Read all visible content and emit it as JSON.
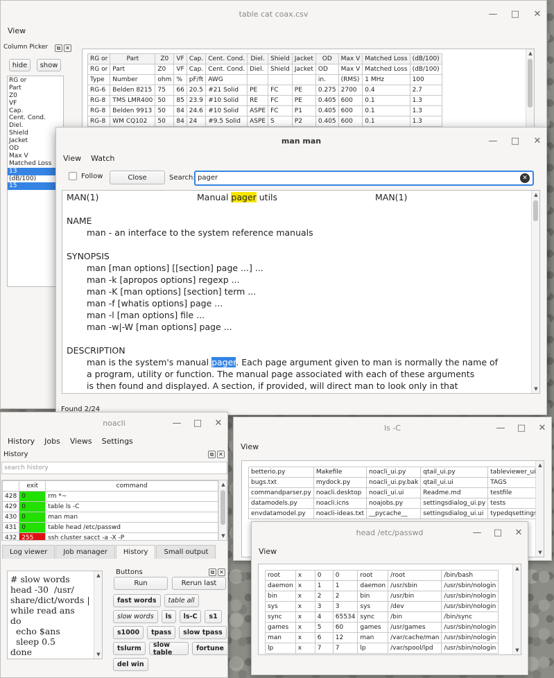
{
  "table_window": {
    "title": "table cat coax.csv",
    "menu": [
      "View"
    ],
    "picker_title": "Column Picker",
    "hide_label": "hide",
    "show_label": "show",
    "columns": [
      {
        "label": "RG or",
        "sel": false
      },
      {
        "label": "Part",
        "sel": false
      },
      {
        "label": "Z0",
        "sel": false
      },
      {
        "label": "VF",
        "sel": false
      },
      {
        "label": "Cap.",
        "sel": false
      },
      {
        "label": "Cent. Cond.",
        "sel": false
      },
      {
        "label": "Diel.",
        "sel": false
      },
      {
        "label": "Shield",
        "sel": false
      },
      {
        "label": "Jacket",
        "sel": false
      },
      {
        "label": "OD",
        "sel": false
      },
      {
        "label": "Max V",
        "sel": false
      },
      {
        "label": "Matched Loss",
        "sel": false
      },
      {
        "label": "13",
        "sel": true
      },
      {
        "label": "(dB/100)",
        "sel": false
      },
      {
        "label": "15",
        "sel": true
      }
    ],
    "headers": [
      "RG or",
      "Part",
      "Z0",
      "VF",
      "Cap.",
      "Cent. Cond.",
      "Diel.",
      "Shield",
      "Jacket",
      "OD",
      "Max V",
      "Matched Loss",
      "(dB/100)"
    ],
    "rows": [
      [
        "RG or",
        "Part",
        "Z0",
        "VF",
        "Cap.",
        "Cent. Cond.",
        "Diel.",
        "Shield",
        "Jacket",
        "OD",
        "Max V",
        "Matched Loss",
        "(dB/100)"
      ],
      [
        "Type",
        "Number",
        "ohm",
        "%",
        "pF/ft",
        "AWG",
        "",
        "",
        "",
        "in.",
        "(RMS)",
        "1 MHz",
        "100"
      ],
      [
        "RG-6",
        "Belden 8215",
        "75",
        "66",
        "20.5",
        "#21 Solid",
        "PE",
        "FC",
        "PE",
        "0.275",
        "2700",
        "0.4",
        "2.7"
      ],
      [
        "RG-8",
        "TMS LMR400",
        "50",
        "85",
        "23.9",
        "#10 Solid",
        "RE",
        "FC",
        "PE",
        "0.405",
        "600",
        "0.1",
        "1.3"
      ],
      [
        "RG-8",
        "Belden 9913",
        "50",
        "84",
        "24.6",
        "#10 Solid",
        "ASPE",
        "FC",
        "P1",
        "0.405",
        "600",
        "0.1",
        "1.3"
      ],
      [
        "RG-8",
        "WM CQ102",
        "50",
        "84",
        "24",
        "#9.5 Solid",
        "ASPE",
        "S",
        "P2",
        "0.405",
        "600",
        "0.1",
        "1.3"
      ]
    ]
  },
  "man_window": {
    "title": "man man",
    "menu": [
      "View",
      "Watch"
    ],
    "follow_label": "Follow",
    "close_label": "Close",
    "search_label": "Search:",
    "search_value": "pager",
    "status": "Found 2/24",
    "head_left": "MAN(1)",
    "head_mid_pre": "Manual ",
    "head_mid_hl": "pager",
    "head_mid_post": " utils",
    "head_right": "MAN(1)",
    "name_h": "NAME",
    "name_line": "man - an interface to the system reference manuals",
    "synopsis_h": "SYNOPSIS",
    "synopsis": [
      "man [man options] [[section] page ...] ...",
      "man -k [apropos options] regexp ...",
      "man -K [man options] [section] term ...",
      "man -f [whatis options] page ...",
      "man -l [man options] file ...",
      "man -w|-W [man options] page ..."
    ],
    "desc_h": "DESCRIPTION",
    "desc1_pre": "man is the system's manual ",
    "desc1_hl": "pager",
    "desc1_post": ".  Each page argument given to man is normally the name of",
    "desc2": "a program, utility or function.  The manual page associated with each of  these  arguments",
    "desc3": "is then found and displayed.  A section, if provided, will direct man to look only in that"
  },
  "noacli_window": {
    "title": "noacli",
    "menu": [
      "History",
      "Jobs",
      "Views",
      "Settings"
    ],
    "history_label": "History",
    "search_placeholder": "search history",
    "col_exit": "exit",
    "col_command": "command",
    "history": [
      {
        "n": "428",
        "exit": "0",
        "cmd": "rm *~",
        "ok": true
      },
      {
        "n": "429",
        "exit": "0",
        "cmd": "table ls -C",
        "ok": true
      },
      {
        "n": "430",
        "exit": "0",
        "cmd": "man man",
        "ok": true
      },
      {
        "n": "431",
        "exit": "0",
        "cmd": "table head /etc/passwd",
        "ok": true
      },
      {
        "n": "432",
        "exit": "255",
        "cmd": "ssh cluster sacct -a -X -P",
        "ok": false
      }
    ],
    "tabs": [
      "Log viewer",
      "Job manager",
      "History",
      "Small output"
    ],
    "editor_lines": [
      "# slow words",
      "head -30  /usr/",
      "share/dict/words |",
      "while read ans",
      "do",
      "  echo $ans",
      "  sleep 0.5",
      "done"
    ],
    "buttons_label": "Buttons",
    "run_label": "Run",
    "rerun_label": "Rerun last",
    "quick_buttons": [
      [
        "fast words",
        "table all"
      ],
      [
        "slow words",
        "ls",
        "ls-C",
        "s1"
      ],
      [
        "s1000",
        "tpass",
        "slow tpass"
      ],
      [
        "tslurm",
        "slow table",
        "fortune"
      ],
      [
        "del win"
      ]
    ]
  },
  "ls_window": {
    "title": "ls -C",
    "menu": [
      "View"
    ],
    "rows": [
      [
        "betterio.py",
        "Makefile",
        "noacli_ui.py",
        "qtail_ui.py",
        "tableviewer_ui.ui"
      ],
      [
        "bugs.txt",
        "mydock.py",
        "noacli_ui.py.bak",
        "qtail_ui.ui",
        "TAGS"
      ],
      [
        "commandparser.py",
        "noacli.desktop",
        "noacli_ui.ui",
        "Readme.md",
        "testfile"
      ],
      [
        "datamodels.py",
        "noacli.icns",
        "noajobs.py",
        "settingsdialog_ui.py",
        "tests"
      ],
      [
        "envdatamodel.py",
        "noacli-ideas.txt",
        "__pycache__",
        "settingsdialog_ui.ui",
        "typedqsettings.py"
      ]
    ]
  },
  "head_window": {
    "title": "head /etc/passwd",
    "menu": [
      "View"
    ],
    "rows": [
      [
        "root",
        "x",
        "0",
        "0",
        "root",
        "/root",
        "/bin/bash"
      ],
      [
        "daemon",
        "x",
        "1",
        "1",
        "daemon",
        "/usr/sbin",
        "/usr/sbin/nologin"
      ],
      [
        "bin",
        "x",
        "2",
        "2",
        "bin",
        "/usr/bin",
        "/usr/sbin/nologin"
      ],
      [
        "sys",
        "x",
        "3",
        "3",
        "sys",
        "/dev",
        "/usr/sbin/nologin"
      ],
      [
        "sync",
        "x",
        "4",
        "65534",
        "sync",
        "/bin",
        "/bin/sync"
      ],
      [
        "games",
        "x",
        "5",
        "60",
        "games",
        "/usr/games",
        "/usr/sbin/nologin"
      ],
      [
        "man",
        "x",
        "6",
        "12",
        "man",
        "/var/cache/man",
        "/usr/sbin/nologin"
      ],
      [
        "lp",
        "x",
        "7",
        "7",
        "lp",
        "/var/spool/lpd",
        "/usr/sbin/nologin"
      ]
    ]
  },
  "colors": {
    "ok": "#22e000",
    "err": "#e01010",
    "select": "#3584e4",
    "highlight": "#f7e600"
  }
}
